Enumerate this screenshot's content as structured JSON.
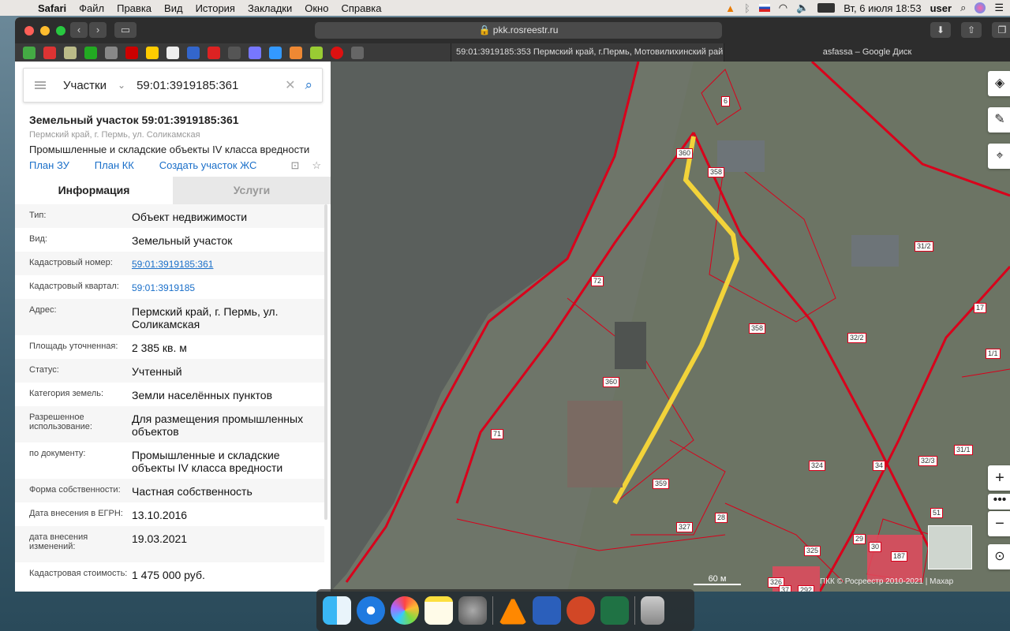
{
  "menubar": {
    "app": "Safari",
    "items": [
      "Файл",
      "Правка",
      "Вид",
      "История",
      "Закладки",
      "Окно",
      "Справка"
    ],
    "clock": "Вт, 6 июля  18:53",
    "user": "user"
  },
  "browser": {
    "url": "pkk.rosreestr.ru",
    "tabs": [
      "59:01:3919185:353 Пермский край, г.Пермь, Мотовилихинский рай...",
      "asfassa – Google Диск"
    ]
  },
  "search": {
    "mode": "Участки",
    "value": "59:01:3919185:361"
  },
  "parcel": {
    "title": "Земельный участок 59:01:3919185:361",
    "address": "Пермский край, г. Пермь, ул. Соликамская",
    "class": "Промышленные и складские объекты IV класса вредности",
    "links": [
      "План ЗУ →",
      "План КК →",
      "Создать участок ЖС →"
    ]
  },
  "tabs": [
    "Информация",
    "Услуги"
  ],
  "info": [
    {
      "k": "Тип:",
      "v": "Объект недвижимости"
    },
    {
      "k": "Вид:",
      "v": "Земельный участок"
    },
    {
      "k": "Кадастровый номер:",
      "v": "59:01:3919185:361",
      "link": true
    },
    {
      "k": "Кадастровый квартал:",
      "v": "59:01:3919185",
      "link": true
    },
    {
      "k": "Адрес:",
      "v": "Пермский край, г. Пермь, ул. Соликамская"
    },
    {
      "k": "Площадь уточненная:",
      "v": "2 385 кв. м"
    },
    {
      "k": "Статус:",
      "v": "Учтенный"
    },
    {
      "k": "Категория земель:",
      "v": "Земли населённых пунктов"
    },
    {
      "k": "Разрешенное использование:",
      "v": "Для размещения промышленных объектов"
    },
    {
      "k": "по документу:",
      "v": "Промышленные и складские объекты IV класса вредности"
    },
    {
      "k": "Форма собственности:",
      "v": "Частная собственность"
    },
    {
      "k": "Дата внесения в ЕГРН:",
      "v": "13.10.2016"
    },
    {
      "k": "дата внесения изменений:",
      "v": "19.03.2021"
    },
    {
      "k": "Кадастровая стоимость:",
      "v": "1 475 000 руб."
    }
  ],
  "map": {
    "labels": [
      "6",
      "360",
      "358",
      "72",
      "358",
      "31/2",
      "17",
      "32/2",
      "1/1",
      "360",
      "71",
      "31/1",
      "324",
      "34",
      "32/3",
      "359",
      "327",
      "28",
      "325",
      "29",
      "30",
      "187",
      "51",
      "326",
      "37",
      "292"
    ],
    "scale": "60 м",
    "attribution": "ПКК © Росреестр 2010-2021 | Махар"
  }
}
